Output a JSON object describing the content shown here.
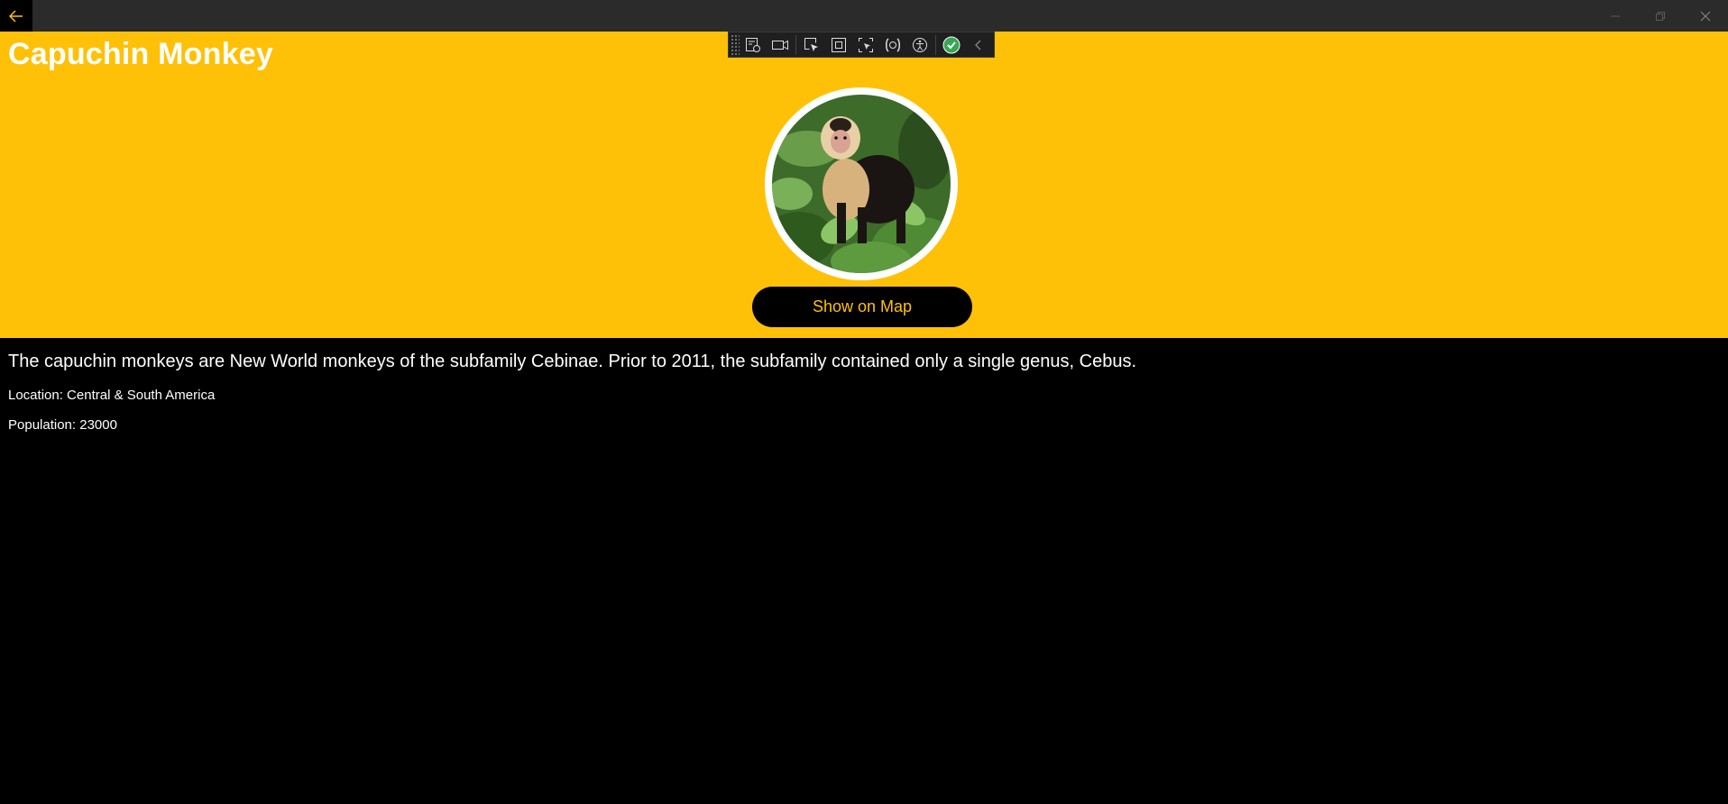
{
  "window": {
    "back_icon": "arrow-left-icon",
    "controls": [
      "minimize-icon",
      "restore-icon",
      "close-icon"
    ]
  },
  "animal": {
    "name": "Capuchin Monkey",
    "image": "capuchin-monkey-photo",
    "map_button_label": "Show on Map",
    "description": "The capuchin monkeys are New World monkeys of the subfamily Cebinae. Prior to 2011, the subfamily contained only a single genus, Cebus.",
    "location_text": "Location: Central & South America",
    "population_text": "Population: 23000"
  },
  "debug_toolbar": {
    "tools": [
      "live-visual-tree-icon",
      "record-icon",
      "select-element-icon",
      "display-layout-adorners-icon",
      "track-focus-icon",
      "binding-failures-icon",
      "accessibility-icon",
      "xaml-hot-reload-status-icon",
      "collapse-chevron-icon"
    ]
  },
  "colors": {
    "accent": "#FFC107",
    "background": "#000000",
    "titlebar": "#2b2b2b",
    "text": "#ffffff"
  }
}
